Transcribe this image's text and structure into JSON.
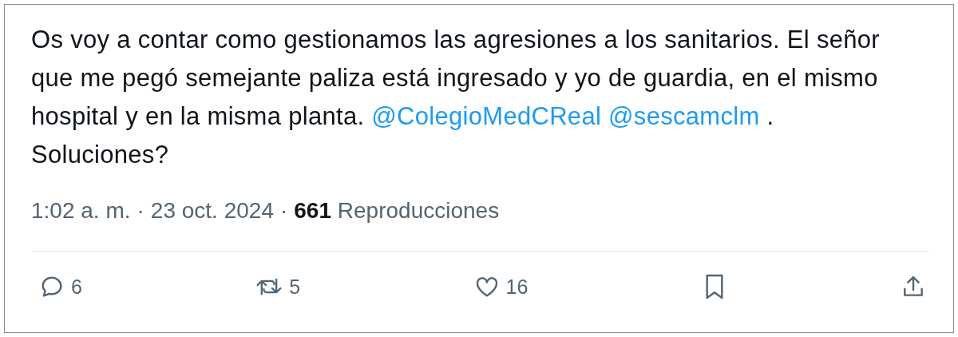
{
  "tweet": {
    "text": [
      {
        "kind": "text",
        "text": "Os voy a contar como gestionamos las agresiones a los sanitarios. El señor que me pegó semejante paliza está ingresado y yo de guardia, en el mismo hospital y en la misma planta. "
      },
      {
        "kind": "mention",
        "text": "@ColegioMedCReal"
      },
      {
        "kind": "mention",
        "text": "@sescamclm"
      },
      {
        "kind": "text",
        "text": ".  Soluciones?"
      }
    ],
    "meta": {
      "time": "1:02 a. m.",
      "separator_1": "·",
      "date": "23 oct. 2024",
      "separator_2": "·",
      "views_count": "661",
      "views_label": "Reproducciones"
    },
    "actions": [
      {
        "kind": "reply",
        "count": "6"
      },
      {
        "kind": "retweet",
        "count": "5"
      },
      {
        "kind": "like",
        "count": "16"
      },
      {
        "kind": "bookmark"
      },
      {
        "kind": "share"
      }
    ]
  }
}
